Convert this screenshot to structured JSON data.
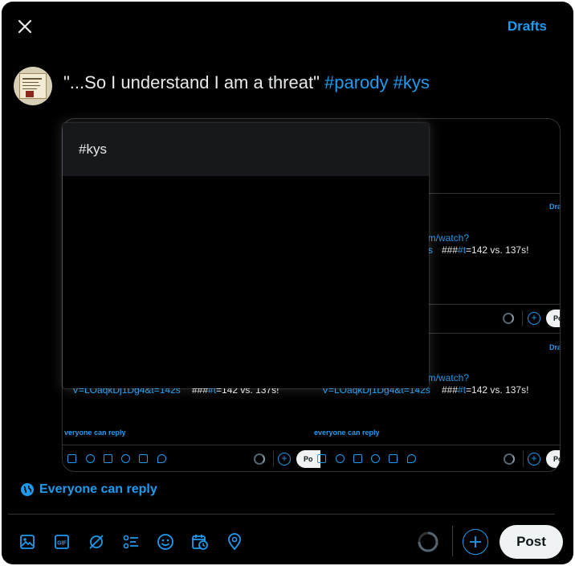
{
  "header": {
    "close_label": "close",
    "drafts_label": "Drafts"
  },
  "composer": {
    "text_main": "\"...So I understand I am a threat\" ",
    "hashtag_1": "#parody",
    "hashtag_2": "#kys"
  },
  "suggestions": {
    "items": [
      {
        "label": "#kys"
      }
    ]
  },
  "preview": {
    "link_fragment": "om/watch?",
    "url_tail_1": "s",
    "url_line_2": "V=LOaqkDj1Dg4&t=142s",
    "hash_prefix": "###",
    "hash_t": "#t",
    "suffix": "=142 vs. 137s!",
    "drafts_short": "Dra",
    "reply_short": "veryone can reply",
    "reply_short_2": "everyone can reply",
    "post_short": "Po"
  },
  "reply_setting": {
    "label": "Everyone can reply"
  },
  "toolbar": {
    "icons": [
      "image-icon",
      "gif-icon",
      "grok-icon",
      "poll-icon",
      "emoji-icon",
      "schedule-icon",
      "location-icon"
    ],
    "post_label": "Post"
  },
  "colors": {
    "accent": "#1d9bf0",
    "background": "#000000",
    "text": "#e7e9ea",
    "post_button_bg": "#eff3f4"
  }
}
